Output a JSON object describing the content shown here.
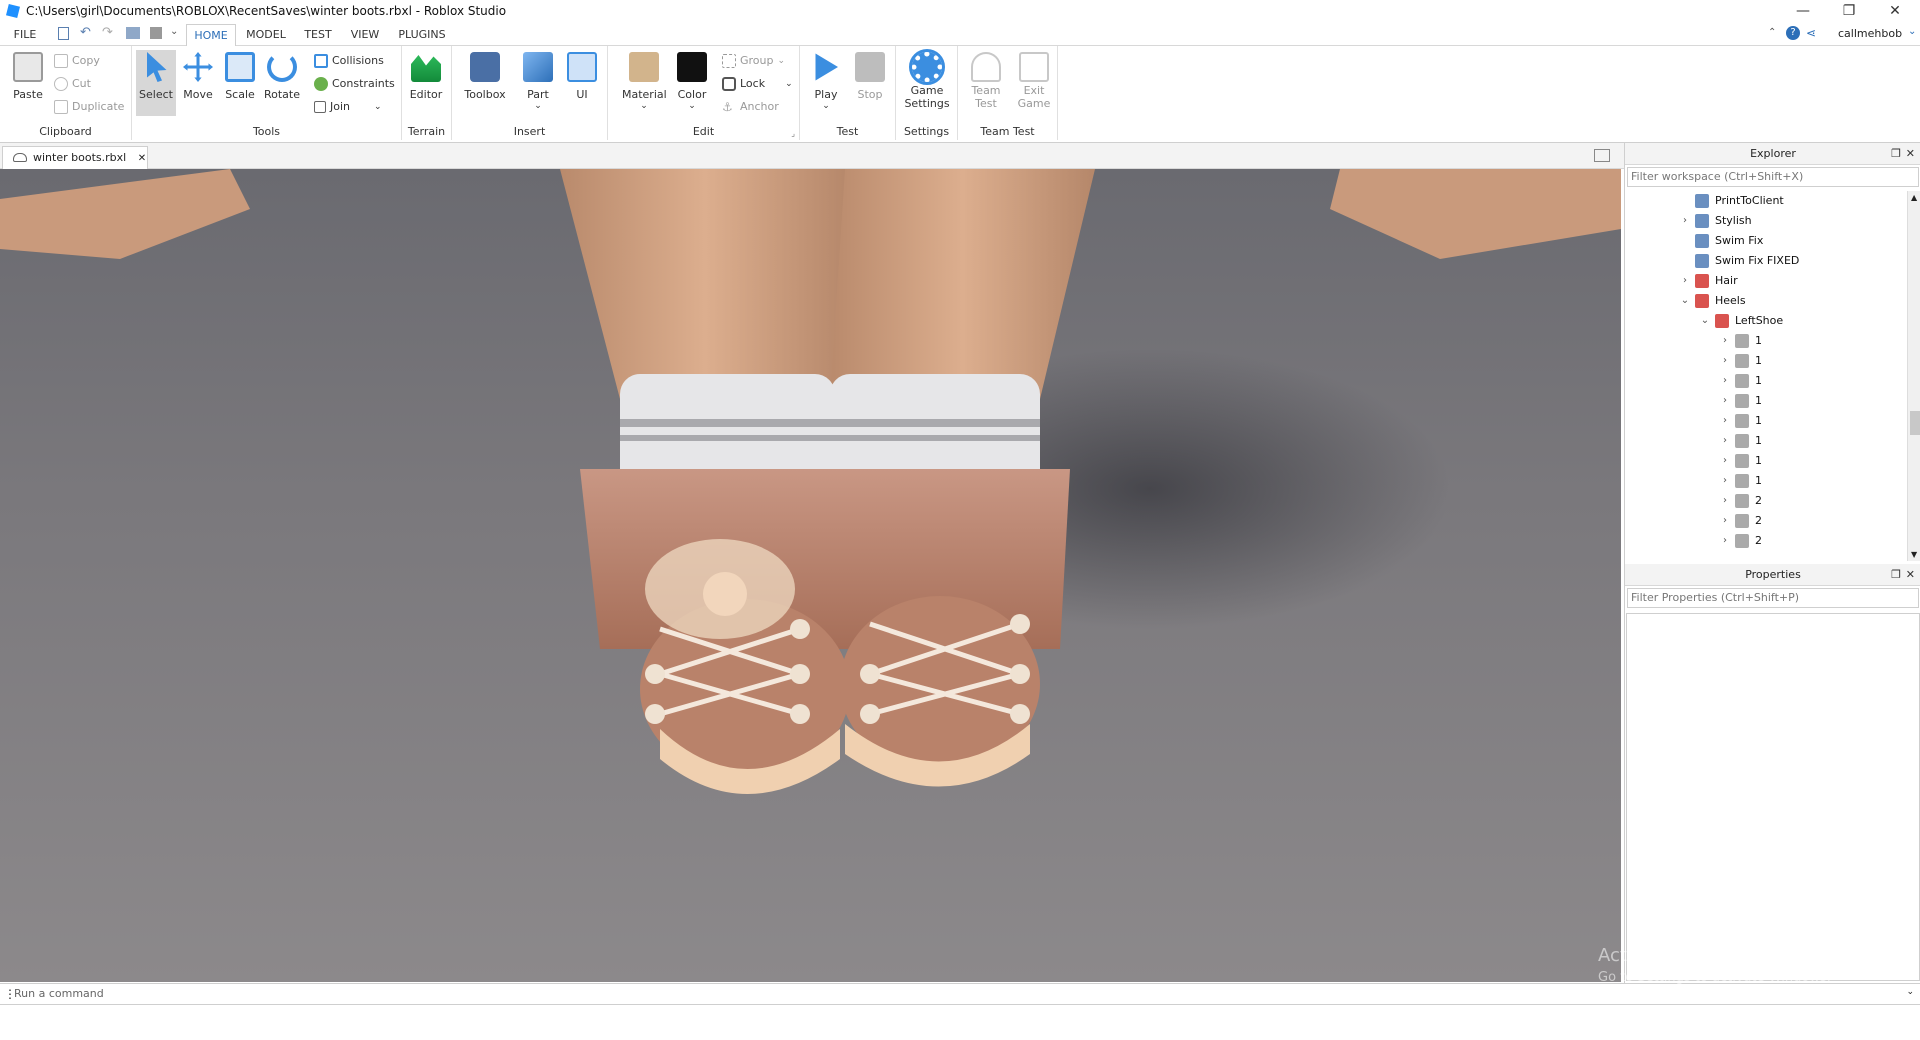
{
  "window": {
    "title": "C:\\Users\\girl\\Documents\\ROBLOX\\RecentSaves\\winter boots.rbxl - Roblox Studio",
    "minimize": "—",
    "restore": "❐",
    "close": "✕"
  },
  "menu": {
    "file": "FILE",
    "tabs": [
      "HOME",
      "MODEL",
      "TEST",
      "VIEW",
      "PLUGINS"
    ],
    "user": "callmehbob"
  },
  "ribbon": {
    "clipboard": {
      "label": "Clipboard",
      "paste": "Paste",
      "copy": "Copy",
      "cut": "Cut",
      "duplicate": "Duplicate"
    },
    "tools": {
      "label": "Tools",
      "select": "Select",
      "move": "Move",
      "scale": "Scale",
      "rotate": "Rotate",
      "collisions": "Collisions",
      "constraints": "Constraints",
      "join": "Join"
    },
    "terrain": {
      "label": "Terrain",
      "editor": "Editor"
    },
    "insert": {
      "label": "Insert",
      "toolbox": "Toolbox",
      "part": "Part",
      "ui": "UI"
    },
    "edit": {
      "label": "Edit",
      "material": "Material",
      "color": "Color",
      "group": "Group",
      "lock": "Lock",
      "anchor": "Anchor"
    },
    "test": {
      "label": "Test",
      "play": "Play",
      "stop": "Stop"
    },
    "settings": {
      "label": "Settings",
      "game_settings_1": "Game",
      "game_settings_2": "Settings"
    },
    "teamtest": {
      "label": "Team Test",
      "team_1": "Team",
      "team_2": "Test",
      "exit_1": "Exit",
      "exit_2": "Game"
    }
  },
  "doc_tab": {
    "name": "winter boots.rbxl",
    "close": "✕"
  },
  "explorer": {
    "title": "Explorer",
    "filter_placeholder": "Filter workspace (Ctrl+Shift+X)",
    "items": [
      {
        "label": "PrintToClient",
        "arrow": ""
      },
      {
        "label": "Stylish",
        "arrow": "›"
      },
      {
        "label": "Swim Fix",
        "arrow": ""
      },
      {
        "label": "Swim Fix FIXED",
        "arrow": ""
      },
      {
        "label": "Hair",
        "arrow": "›"
      },
      {
        "label": "Heels",
        "arrow": "⌄"
      },
      {
        "label": "LeftShoe",
        "arrow": "⌄"
      },
      {
        "label": "1",
        "arrow": "›"
      },
      {
        "label": "1",
        "arrow": "›"
      },
      {
        "label": "1",
        "arrow": "›"
      },
      {
        "label": "1",
        "arrow": "›"
      },
      {
        "label": "1",
        "arrow": "›"
      },
      {
        "label": "1",
        "arrow": "›"
      },
      {
        "label": "1",
        "arrow": "›"
      },
      {
        "label": "1",
        "arrow": "›"
      },
      {
        "label": "2",
        "arrow": "›"
      },
      {
        "label": "2",
        "arrow": "›"
      },
      {
        "label": "2",
        "arrow": "›"
      }
    ]
  },
  "properties": {
    "title": "Properties",
    "filter_placeholder": "Filter Properties (Ctrl+Shift+P)"
  },
  "command": {
    "placeholder": "Run a command"
  },
  "watermark": {
    "line1": "Activate Windows",
    "line2": "Go to Settings to activate Windows."
  },
  "colors": {
    "accent": "#2d6fb8",
    "skin": "#d7a98a",
    "boot": "#b9826a",
    "floor": "#7c797d"
  }
}
